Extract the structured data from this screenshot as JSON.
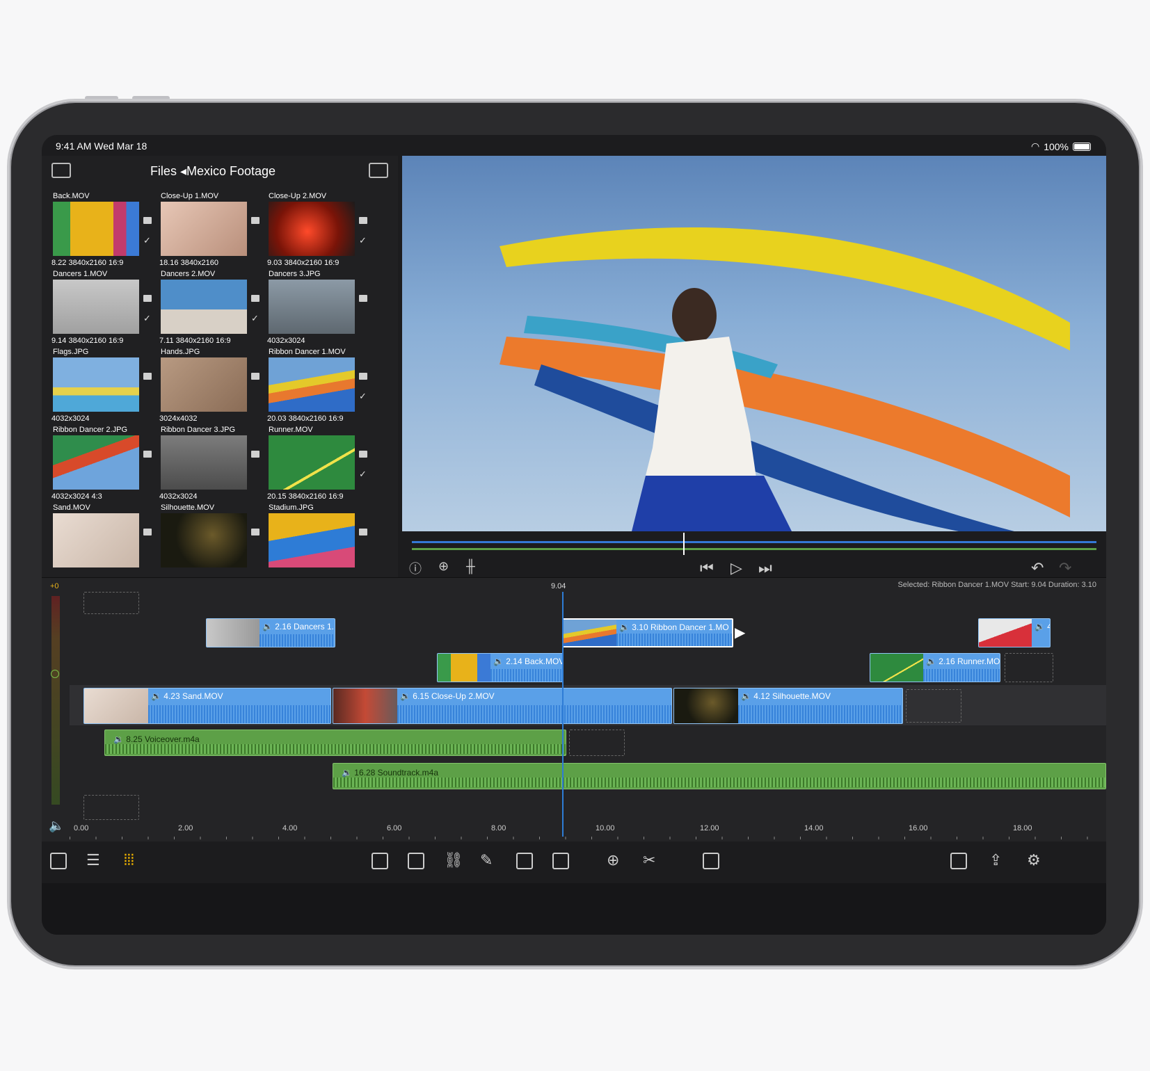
{
  "status": {
    "time": "9:41 AM   Wed Mar 18",
    "battery": "100%"
  },
  "browser": {
    "title": "Files ◂Mexico Footage",
    "items": [
      {
        "name": "Back.MOV",
        "meta": "8.22  3840x2160  16:9",
        "type": "video",
        "checked": true
      },
      {
        "name": "Close-Up 1.MOV",
        "meta": "18.16  3840x2160",
        "type": "video",
        "checked": false
      },
      {
        "name": "Close-Up 2.MOV",
        "meta": "9.03  3840x2160  16:9",
        "type": "video",
        "checked": true
      },
      {
        "name": "Dancers 1.MOV",
        "meta": "9.14  3840x2160  16:9",
        "type": "video",
        "checked": true
      },
      {
        "name": "Dancers 2.MOV",
        "meta": "7.11  3840x2160  16:9",
        "type": "video",
        "checked": true
      },
      {
        "name": "Dancers 3.JPG",
        "meta": "4032x3024",
        "type": "image",
        "checked": false
      },
      {
        "name": "Flags.JPG",
        "meta": "4032x3024",
        "type": "image",
        "checked": false
      },
      {
        "name": "Hands.JPG",
        "meta": "3024x4032",
        "type": "image",
        "checked": false
      },
      {
        "name": "Ribbon Dancer 1.MOV",
        "meta": "20.03  3840x2160  16:9",
        "type": "video",
        "checked": true
      },
      {
        "name": "Ribbon Dancer 2.JPG",
        "meta": "4032x3024  4:3",
        "type": "image",
        "checked": false
      },
      {
        "name": "Ribbon Dancer 3.JPG",
        "meta": "4032x3024",
        "type": "image",
        "checked": false
      },
      {
        "name": "Runner.MOV",
        "meta": "20.15  3840x2160  16:9",
        "type": "video",
        "checked": true
      },
      {
        "name": "Sand.MOV",
        "meta": "",
        "type": "video",
        "checked": false
      },
      {
        "name": "Silhouette.MOV",
        "meta": "",
        "type": "video",
        "checked": false
      },
      {
        "name": "Stadium.JPG",
        "meta": "",
        "type": "image",
        "checked": false
      }
    ]
  },
  "timeline": {
    "meter_label": "+0",
    "playhead": "9.04",
    "selection_info": "Selected: Ribbon Dancer 1.MOV Start: 9.04 Duration: 3.10",
    "clips": {
      "dancers": "🔉 2.16  Dancers 1.",
      "ribbon": "🔉 3.10  Ribbon Dancer 1.MO",
      "right_clip": "🔉 4",
      "back": "🔉 2.14  Back.MOV",
      "runner": "🔉 2.16  Runner.MO",
      "sand": "🔉 4.23  Sand.MOV",
      "closeup": "🔉 6.15  Close-Up 2.MOV",
      "silhouette": "🔉 4.12  Silhouette.MOV",
      "voiceover": "🔉 8.25  Voiceover.m4a",
      "soundtrack": "🔉 16.28  Soundtrack.m4a"
    },
    "ruler": [
      "0.00",
      "2.00",
      "4.00",
      "6.00",
      "8.00",
      "10.00",
      "12.00",
      "14.00",
      "16.00",
      "18.00"
    ]
  },
  "colors": {
    "video_clip": "#5aa0e8",
    "audio_clip": "#5da047",
    "accent": "#0a84ff",
    "tool_active": "#f0b400"
  }
}
